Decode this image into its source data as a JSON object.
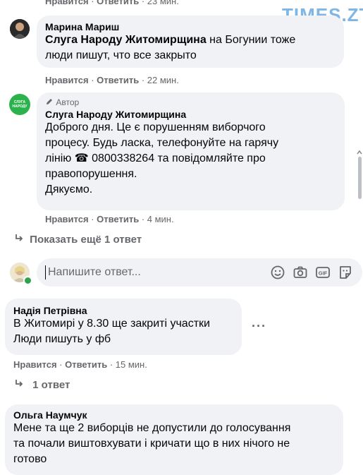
{
  "watermark": "TIMES.ZT",
  "top_meta": {
    "like": "Нравится",
    "reply": "Ответить",
    "time": "23 мин."
  },
  "comment1": {
    "author": "Марина Мариш",
    "mention": "Слуга Народу Житомирщина",
    "text_line1_rest": " на Богунии тоже",
    "text_line2": "люди пишут, что все закрыто",
    "like": "Нравится",
    "reply": "Ответить",
    "time": "22 мин."
  },
  "comment2": {
    "badge": "Автор",
    "avatar_text_1": "СЛУГА",
    "avatar_text_2": "НАРОДУ",
    "author": "Слуга Народу Житомирщина",
    "lines": [
      "Доброго дня. Це є порушенням виборчого",
      "процесу. Будь ласка, телефонуйте на гарячу",
      "лінію ☎ 0800338264 та повідомляйте про",
      "правопорушення.",
      "Дякуємо."
    ],
    "like": "Нравится",
    "reply": "Ответить",
    "time": "4 мин."
  },
  "more_replies": "Показать ещё 1 ответ",
  "reply_box": {
    "placeholder": "Напишите ответ..."
  },
  "comment3": {
    "author": "Надія Петрівна",
    "lines": [
      "В Житомирі у 8.30 ще закриті участки",
      "Люди пишуть у фб"
    ],
    "like": "Нравится",
    "reply": "Ответить",
    "time": "15 мин.",
    "replies": "1 ответ"
  },
  "comment4": {
    "author": "Ольга Наумчук",
    "lines": [
      "Мене та ще 2 виборців не допустили до голосування",
      "та почали виштовхувати і кричати що в них нічого не",
      "готово"
    ]
  },
  "colors": {
    "bubble": "#f0f2f5",
    "meta": "#65676b",
    "text": "#050505",
    "online": "#31a24c",
    "brand_green": "#2bb24c"
  }
}
